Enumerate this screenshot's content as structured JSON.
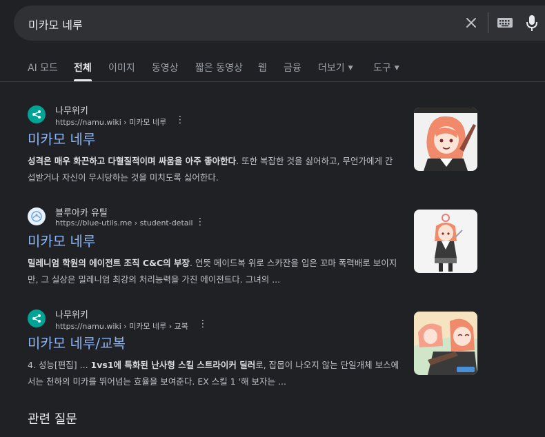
{
  "search": {
    "query": "미카모 네루"
  },
  "tabs": [
    {
      "label": "AI 모드"
    },
    {
      "label": "전체"
    },
    {
      "label": "이미지"
    },
    {
      "label": "동영상"
    },
    {
      "label": "짧은 동영상"
    },
    {
      "label": "웹"
    },
    {
      "label": "금융"
    },
    {
      "label": "더보기"
    },
    {
      "label": "도구"
    }
  ],
  "results": [
    {
      "site": "나무위키",
      "url": "https://namu.wiki › 미카모 네루",
      "title": "미카모 네루",
      "snippet_bold": "성격은 매우 화끈하고 다혈질적이며 싸움을 아주 좋아한다",
      "snippet_rest": ". 또한 복잡한 것을 싫어하고, 무언가에게 간섭받거나 자신이 무시당하는 것을 미치도록 싫어한다."
    },
    {
      "site": "블루아카 유틸",
      "url": "https://blue-utils.me › student-detail",
      "title": "미카모 네루",
      "snippet_bold": "밀레니엄 학원의 에이전트 조직 C&C의 부장",
      "snippet_rest": ". 언뜻 메이드복 위로 스카잔을 입은 꼬마 폭력배로 보이지만, 그 실상은 밀레니엄 최강의 처리능력을 가진 에이전트다. 그녀의 ..."
    },
    {
      "site": "나무위키",
      "url": "https://namu.wiki › 미카모 네루 › 교복",
      "title": "미카모 네루/교복",
      "snippet_pre": "4. 성능[편집] ... ",
      "snippet_bold": "1vs1에 특화된 난사형 스킬 스트라이커 딜러",
      "snippet_rest": "로, 잡몹이 나오지 않는 단일개체 보스에서는 천하의 미카를 뛰어넘는 효율을 보여준다. EX 스킬 1 '해 보자는 ..."
    }
  ],
  "related": {
    "heading": "관련 질문"
  },
  "colors": {
    "background": "#202124",
    "link": "#8ab4f8",
    "namu_brand": "#00a495"
  }
}
